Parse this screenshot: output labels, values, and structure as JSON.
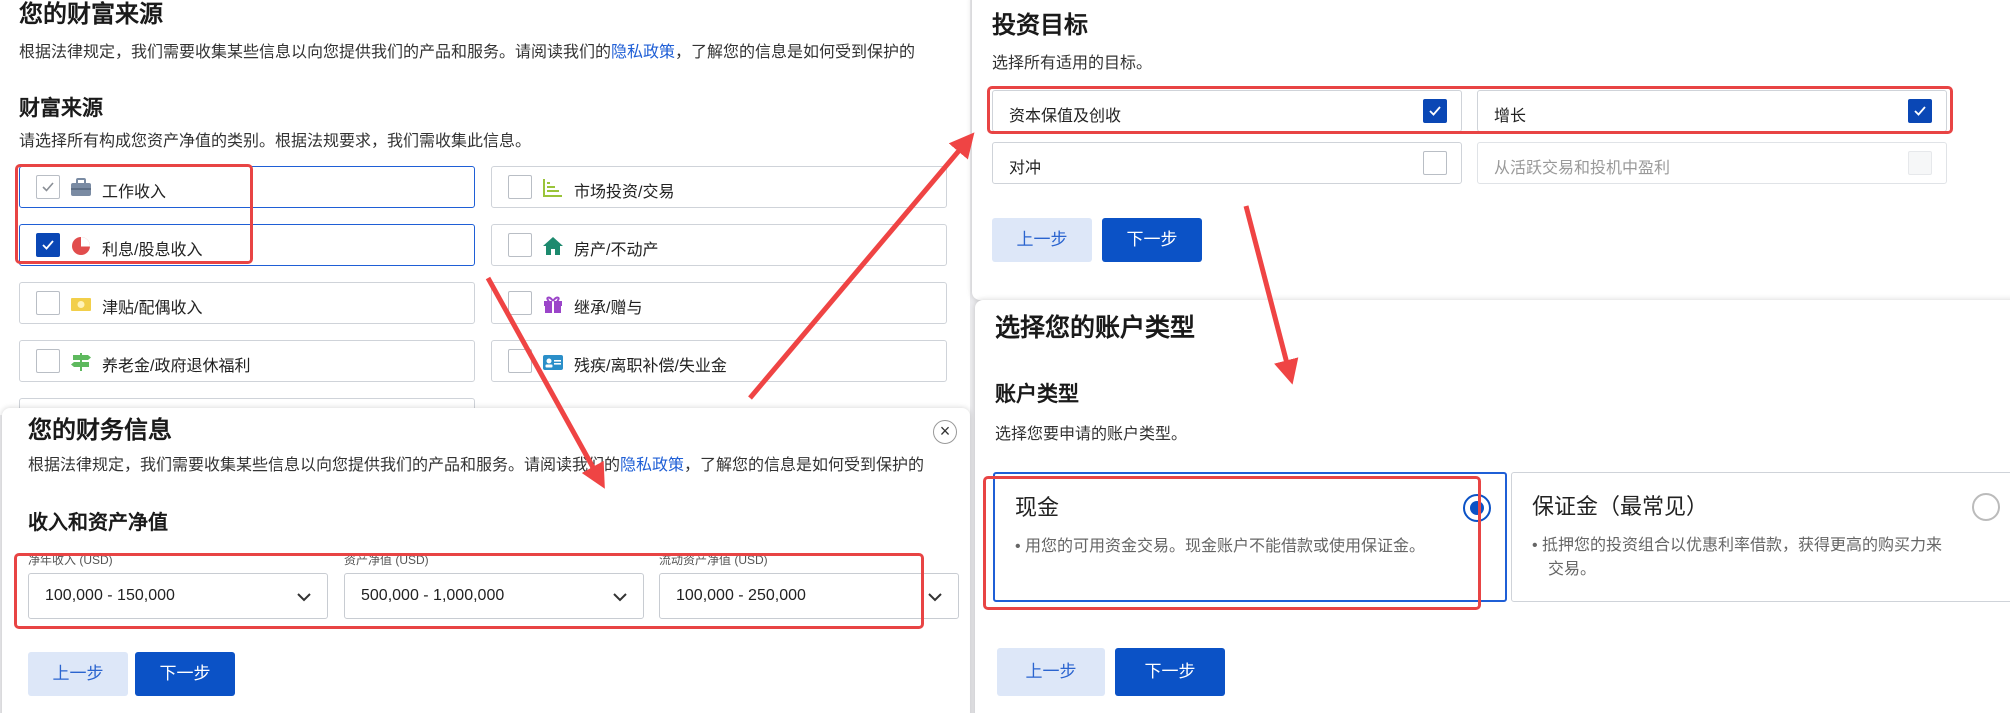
{
  "wealth": {
    "title": "您的财富来源",
    "desc_pre": "根据法律规定，我们需要收集某些信息以向您提供我们的产品和服务。请阅读我们的",
    "privacy_link": "隐私政策",
    "desc_post": "，了解您的信息是如何受到保护的",
    "section": "财富来源",
    "section_desc": "请选择所有构成您资产净值的类别。根据法规要求，我们需收集此信息。",
    "options": [
      {
        "label": "工作收入",
        "checked": "light",
        "icon": "briefcase-icon"
      },
      {
        "label": "市场投资/交易",
        "checked": "no",
        "icon": "bar-chart-icon"
      },
      {
        "label": "利息/股息收入",
        "checked": "yes",
        "icon": "pie-chart-icon"
      },
      {
        "label": "房产/不动产",
        "checked": "no",
        "icon": "house-icon"
      },
      {
        "label": "津贴/配偶收入",
        "checked": "no",
        "icon": "money-icon"
      },
      {
        "label": "继承/赠与",
        "checked": "no",
        "icon": "gift-icon"
      },
      {
        "label": "养老金/政府退休福利",
        "checked": "no",
        "icon": "signpost-icon"
      },
      {
        "label": "残疾/离职补偿/失业金",
        "checked": "no",
        "icon": "id-card-icon"
      }
    ],
    "colors": {
      "accent": "#0a47b5",
      "highlight": "#e84444"
    }
  },
  "goals": {
    "title": "投资目标",
    "desc": "选择所有适用的目标。",
    "options": [
      {
        "label": "资本保值及创收",
        "checked": "yes"
      },
      {
        "label": "增长",
        "checked": "yes"
      },
      {
        "label": "对冲",
        "checked": "no"
      },
      {
        "label": "从活跃交易和投机中盈利",
        "checked": "disabled"
      }
    ],
    "prev": "上一步",
    "next": "下一步"
  },
  "finance": {
    "title": "您的财务信息",
    "desc_pre": "根据法律规定，我们需要收集某些信息以向您提供我们的产品和服务。请阅读我们的",
    "privacy_link": "隐私政策",
    "desc_post": "，了解您的信息是如何受到保护的",
    "section": "收入和资产净值",
    "fields": [
      {
        "label": "净年收入 (USD)",
        "value": "100,000 - 150,000"
      },
      {
        "label": "资产净值 (USD)",
        "value": "500,000 - 1,000,000"
      },
      {
        "label": "流动资产净值 (USD)",
        "value": "100,000 - 250,000"
      }
    ],
    "close": "×",
    "prev": "上一步",
    "next": "下一步"
  },
  "account": {
    "title": "选择您的账户类型",
    "section": "账户类型",
    "section_desc": "选择您要申请的账户类型。",
    "cards": [
      {
        "title": "现金",
        "desc1": "• 用您的可用资金交易。现金账户不能借款或使用保证金。",
        "desc2": "",
        "selected": true
      },
      {
        "title": "保证金（最常见）",
        "desc1": "• 抵押您的投资组合以优惠利率借款，获得更高的购买力来",
        "desc2": "交易。",
        "selected": false
      }
    ],
    "prev": "上一步",
    "next": "下一步"
  }
}
